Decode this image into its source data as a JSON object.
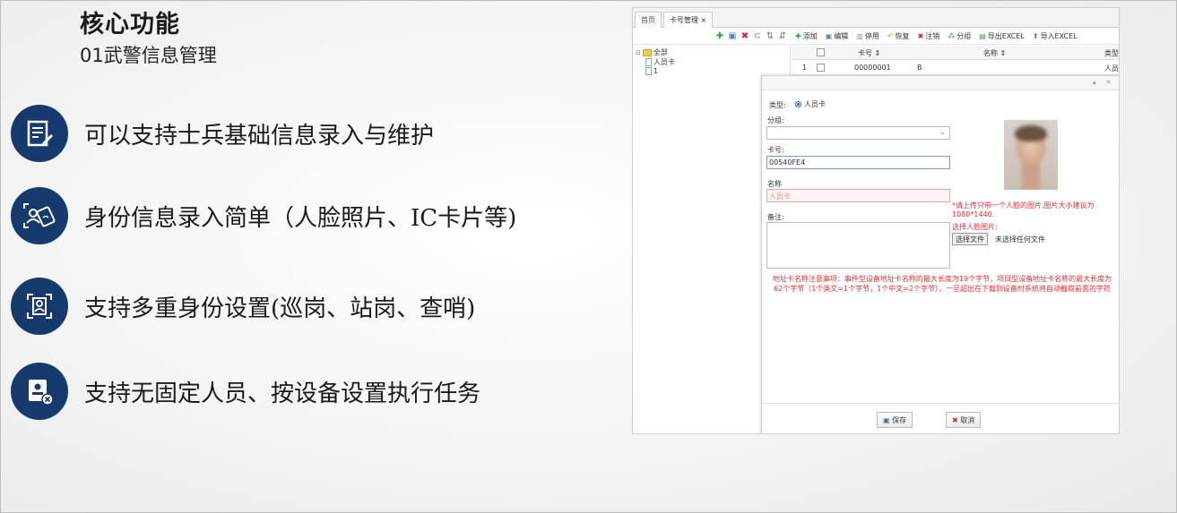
{
  "slide": {
    "title": "核心功能",
    "subtitle": "01武警信息管理",
    "accent_color": "#173a6e",
    "features": [
      {
        "icon": "form-edit-icon",
        "text": "可以支持士兵基础信息录入与维护"
      },
      {
        "icon": "face-card-scan-icon",
        "text": "身份信息录入简单（人脸照片、IC卡片等)"
      },
      {
        "icon": "id-frame-icon",
        "text": "支持多重身份设置(巡岗、站岗、查哨)"
      },
      {
        "icon": "person-remove-icon",
        "text": "支持无固定人员、按设备设置执行任务"
      }
    ]
  },
  "app": {
    "tabs": [
      {
        "label": "首页"
      },
      {
        "label": "卡号管理 ×"
      }
    ],
    "tree": {
      "root": "全部",
      "children": [
        "人员卡",
        "1"
      ]
    },
    "grid_toolbar": [
      "添加",
      "编辑",
      "停用",
      "恢复",
      "注销",
      "分组",
      "导出EXCEL",
      "导入EXCEL"
    ],
    "grid_columns": [
      "卡号 ⇕",
      "名称 ⇕",
      "类型"
    ],
    "grid_rows": [
      {
        "index": "1",
        "card": "00000001",
        "name": "B",
        "type": "人员卡"
      }
    ],
    "dialog": {
      "type_label": "类型:",
      "type_value": "人员卡",
      "group_label": "分组:",
      "card_label": "卡号:",
      "card_value": "00540FE4",
      "name_label": "名称",
      "name_placeholder": "人员卡",
      "remark_label": "备注:",
      "photo_hint": "*请上传只带一个人脸的图片,图片大小建议为1080*1440.",
      "photo_select": "选择人脸图片:",
      "file_button": "选择文件",
      "file_status": "未选择任何文件",
      "notice": "地址卡名称注意事项：事件型设备地址卡名称的最大长度为19个字节，项目型设备地址卡名称的最大长度为62个字节（1个英文=1个字节，1个中文=2个字节），一旦超出在下载到设备时系统将自动截取前面的字符",
      "save_label": "保存",
      "cancel_label": "取消",
      "header_controls": "▴ ×"
    }
  }
}
